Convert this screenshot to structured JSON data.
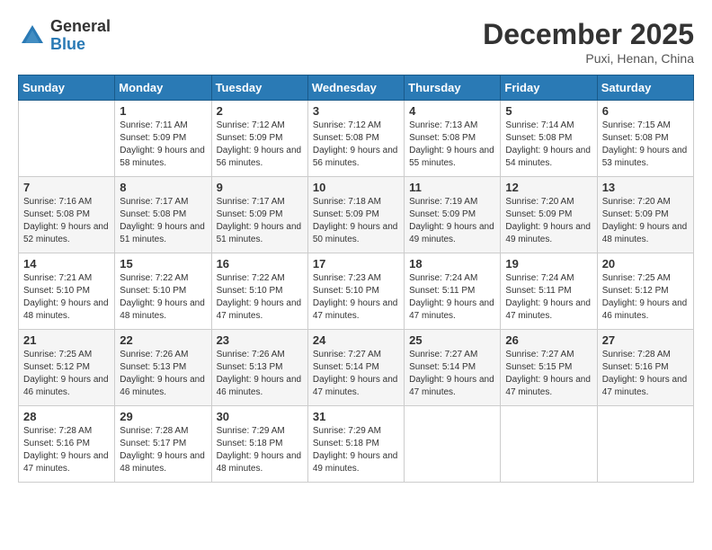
{
  "logo": {
    "general": "General",
    "blue": "Blue"
  },
  "title": {
    "month": "December 2025",
    "location": "Puxi, Henan, China"
  },
  "days_of_week": [
    "Sunday",
    "Monday",
    "Tuesday",
    "Wednesday",
    "Thursday",
    "Friday",
    "Saturday"
  ],
  "weeks": [
    [
      {
        "day": "",
        "sunrise": "",
        "sunset": "",
        "daylight": ""
      },
      {
        "day": "1",
        "sunrise": "7:11 AM",
        "sunset": "5:09 PM",
        "daylight": "9 hours and 58 minutes."
      },
      {
        "day": "2",
        "sunrise": "7:12 AM",
        "sunset": "5:09 PM",
        "daylight": "9 hours and 56 minutes."
      },
      {
        "day": "3",
        "sunrise": "7:12 AM",
        "sunset": "5:08 PM",
        "daylight": "9 hours and 56 minutes."
      },
      {
        "day": "4",
        "sunrise": "7:13 AM",
        "sunset": "5:08 PM",
        "daylight": "9 hours and 55 minutes."
      },
      {
        "day": "5",
        "sunrise": "7:14 AM",
        "sunset": "5:08 PM",
        "daylight": "9 hours and 54 minutes."
      },
      {
        "day": "6",
        "sunrise": "7:15 AM",
        "sunset": "5:08 PM",
        "daylight": "9 hours and 53 minutes."
      }
    ],
    [
      {
        "day": "7",
        "sunrise": "7:16 AM",
        "sunset": "5:08 PM",
        "daylight": "9 hours and 52 minutes."
      },
      {
        "day": "8",
        "sunrise": "7:17 AM",
        "sunset": "5:08 PM",
        "daylight": "9 hours and 51 minutes."
      },
      {
        "day": "9",
        "sunrise": "7:17 AM",
        "sunset": "5:09 PM",
        "daylight": "9 hours and 51 minutes."
      },
      {
        "day": "10",
        "sunrise": "7:18 AM",
        "sunset": "5:09 PM",
        "daylight": "9 hours and 50 minutes."
      },
      {
        "day": "11",
        "sunrise": "7:19 AM",
        "sunset": "5:09 PM",
        "daylight": "9 hours and 49 minutes."
      },
      {
        "day": "12",
        "sunrise": "7:20 AM",
        "sunset": "5:09 PM",
        "daylight": "9 hours and 49 minutes."
      },
      {
        "day": "13",
        "sunrise": "7:20 AM",
        "sunset": "5:09 PM",
        "daylight": "9 hours and 48 minutes."
      }
    ],
    [
      {
        "day": "14",
        "sunrise": "7:21 AM",
        "sunset": "5:10 PM",
        "daylight": "9 hours and 48 minutes."
      },
      {
        "day": "15",
        "sunrise": "7:22 AM",
        "sunset": "5:10 PM",
        "daylight": "9 hours and 48 minutes."
      },
      {
        "day": "16",
        "sunrise": "7:22 AM",
        "sunset": "5:10 PM",
        "daylight": "9 hours and 47 minutes."
      },
      {
        "day": "17",
        "sunrise": "7:23 AM",
        "sunset": "5:10 PM",
        "daylight": "9 hours and 47 minutes."
      },
      {
        "day": "18",
        "sunrise": "7:24 AM",
        "sunset": "5:11 PM",
        "daylight": "9 hours and 47 minutes."
      },
      {
        "day": "19",
        "sunrise": "7:24 AM",
        "sunset": "5:11 PM",
        "daylight": "9 hours and 47 minutes."
      },
      {
        "day": "20",
        "sunrise": "7:25 AM",
        "sunset": "5:12 PM",
        "daylight": "9 hours and 46 minutes."
      }
    ],
    [
      {
        "day": "21",
        "sunrise": "7:25 AM",
        "sunset": "5:12 PM",
        "daylight": "9 hours and 46 minutes."
      },
      {
        "day": "22",
        "sunrise": "7:26 AM",
        "sunset": "5:13 PM",
        "daylight": "9 hours and 46 minutes."
      },
      {
        "day": "23",
        "sunrise": "7:26 AM",
        "sunset": "5:13 PM",
        "daylight": "9 hours and 46 minutes."
      },
      {
        "day": "24",
        "sunrise": "7:27 AM",
        "sunset": "5:14 PM",
        "daylight": "9 hours and 47 minutes."
      },
      {
        "day": "25",
        "sunrise": "7:27 AM",
        "sunset": "5:14 PM",
        "daylight": "9 hours and 47 minutes."
      },
      {
        "day": "26",
        "sunrise": "7:27 AM",
        "sunset": "5:15 PM",
        "daylight": "9 hours and 47 minutes."
      },
      {
        "day": "27",
        "sunrise": "7:28 AM",
        "sunset": "5:16 PM",
        "daylight": "9 hours and 47 minutes."
      }
    ],
    [
      {
        "day": "28",
        "sunrise": "7:28 AM",
        "sunset": "5:16 PM",
        "daylight": "9 hours and 47 minutes."
      },
      {
        "day": "29",
        "sunrise": "7:28 AM",
        "sunset": "5:17 PM",
        "daylight": "9 hours and 48 minutes."
      },
      {
        "day": "30",
        "sunrise": "7:29 AM",
        "sunset": "5:18 PM",
        "daylight": "9 hours and 48 minutes."
      },
      {
        "day": "31",
        "sunrise": "7:29 AM",
        "sunset": "5:18 PM",
        "daylight": "9 hours and 49 minutes."
      },
      {
        "day": "",
        "sunrise": "",
        "sunset": "",
        "daylight": ""
      },
      {
        "day": "",
        "sunrise": "",
        "sunset": "",
        "daylight": ""
      },
      {
        "day": "",
        "sunrise": "",
        "sunset": "",
        "daylight": ""
      }
    ]
  ],
  "labels": {
    "sunrise": "Sunrise:",
    "sunset": "Sunset:",
    "daylight": "Daylight:"
  }
}
